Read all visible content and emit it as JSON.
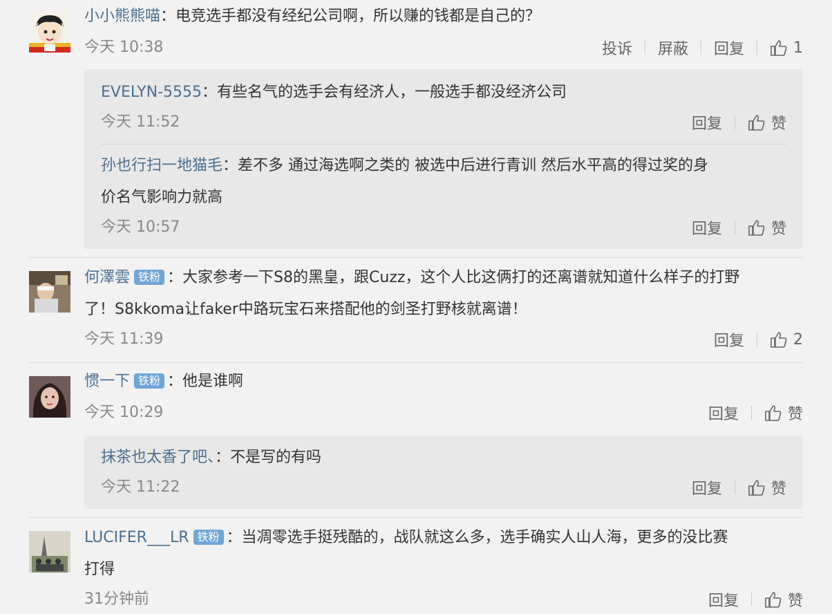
{
  "comments": [
    {
      "user": "小小熊熊喵",
      "sep": "：",
      "text": "电竞选手都没有经纪公司啊，所以赚的钱都是自己的？",
      "time": "今天 10:38",
      "actions": [
        "投诉",
        "屏蔽",
        "回复"
      ],
      "likes": "1",
      "replies": [
        {
          "user": "EVELYN-5555",
          "sep": "：",
          "text": "有些名气的选手会有经济人，一般选手都没经济公司",
          "time": "今天 11:52",
          "reply": "回复",
          "likes": "赞"
        },
        {
          "user": "孙也行扫一地猫毛",
          "sep": "：",
          "text": "差不多  通过海选啊之类的  被选中后进行青训  然后水平高的得过奖的身",
          "text2": "价名气影响力就高",
          "time": "今天 10:57",
          "reply": "回复",
          "likes": "赞"
        }
      ]
    },
    {
      "user": "何澤雲",
      "badge": "铁粉",
      "sep": "：",
      "text": "大家参考一下S8的黑皇，跟Cuzz，这个人比这俩打的还离谱就知道什么样子的打野",
      "text2": "了！S8kkoma让faker中路玩宝石来搭配他的剑圣打野核就离谱！",
      "time": "今天 11:39",
      "reply": "回复",
      "likes": "2"
    },
    {
      "user": "惯一下",
      "badge": "铁粉",
      "sep": "：",
      "text": "他是谁啊",
      "time": "今天 10:29",
      "reply": "回复",
      "likes": "赞",
      "replies": [
        {
          "user": "抹茶也太香了吧、",
          "sep": "：",
          "text": "不是写的有吗",
          "time": "今天 11:22",
          "reply": "回复",
          "likes": "赞"
        }
      ]
    },
    {
      "user": "LUCIFER___LR",
      "badge": "铁粉",
      "sep": "：",
      "text": "当凋零选手挺残酷的，战队就这么多，选手确实人山人海，更多的没比赛",
      "text2": "打得",
      "time": "31分钟前",
      "reply": "回复",
      "likes": "赞"
    }
  ],
  "colors": {
    "background": "#f2f2f2",
    "username": "#4b6f8f",
    "badge": "#6fa6d6",
    "reply_box": "#e8e8e8"
  }
}
